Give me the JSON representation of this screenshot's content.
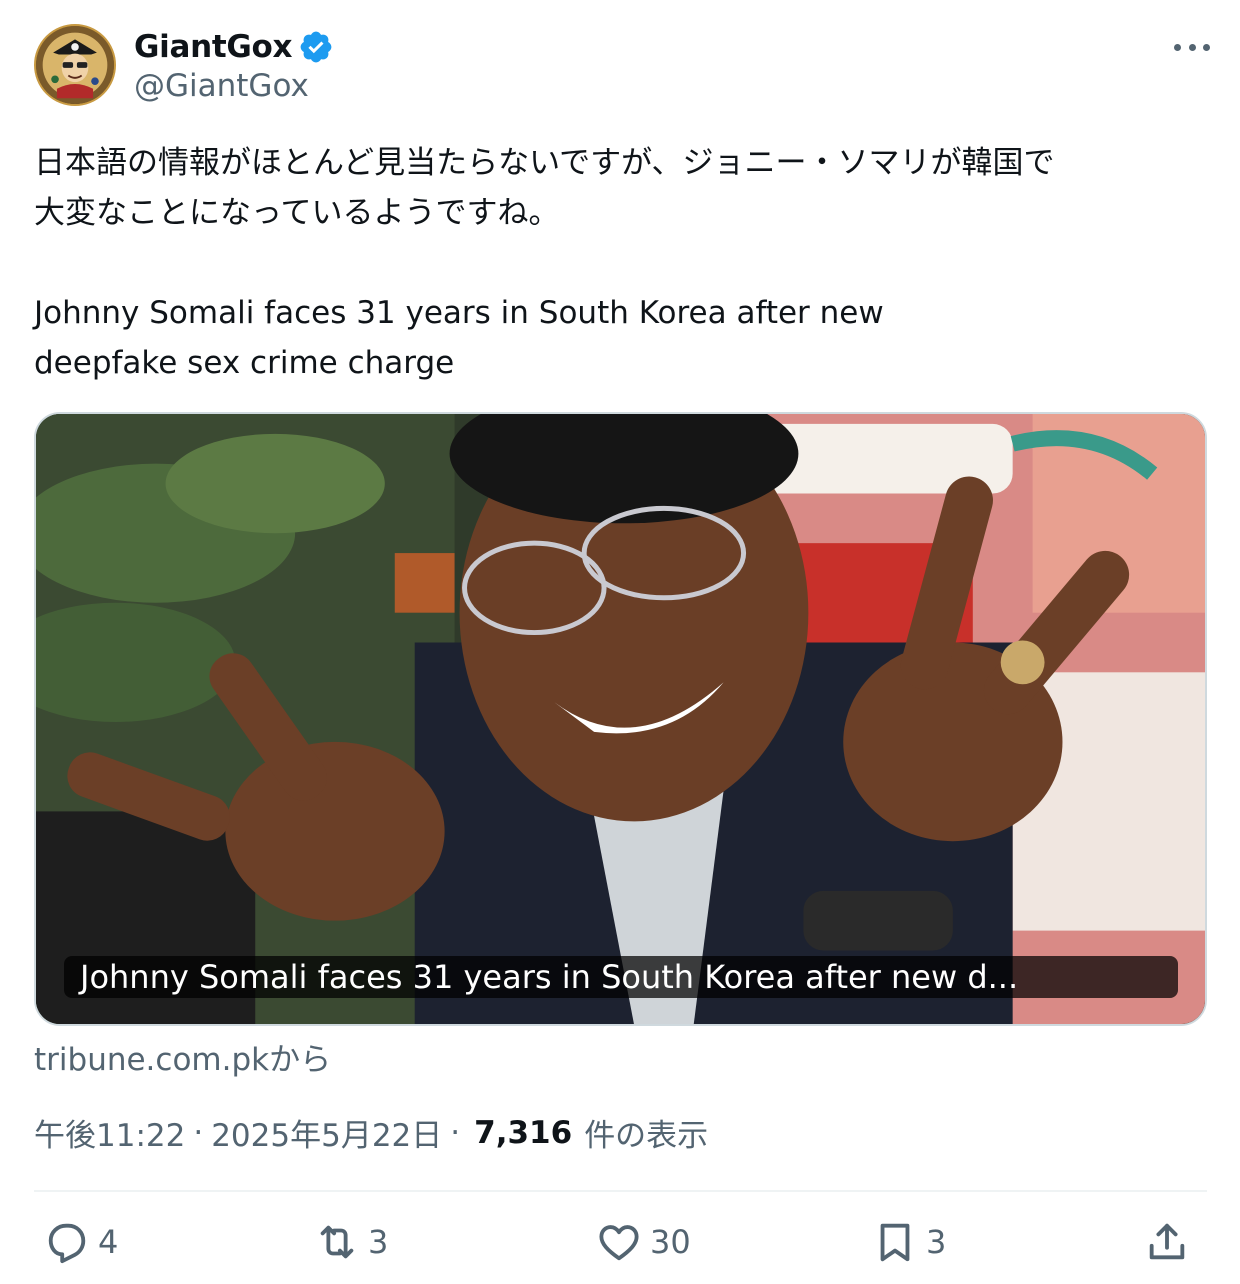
{
  "author": {
    "display_name": "GiantGox",
    "handle": "@GiantGox",
    "verified": true,
    "verified_color": "#1d9bf0"
  },
  "tweet": {
    "text_jp_line1": "日本語の情報がほとんど見当たらないですが、ジョニー・ソマリが韓国で",
    "text_jp_line2": "大変なことになっているようですね。",
    "text_en_line1": "Johnny Somali faces 31 years in South Korea after new",
    "text_en_line2": "deepfake sex crime charge"
  },
  "card": {
    "caption": "Johnny Somali faces 31 years in South Korea after new d...",
    "source": "tribune.com.pkから"
  },
  "meta": {
    "time": "午後11:22",
    "date": "2025年5月22日",
    "views_count": "7,316",
    "views_label": "件の表示",
    "separator": "·"
  },
  "actions": {
    "replies": "4",
    "reposts": "3",
    "likes": "30",
    "bookmarks": "3"
  },
  "icons": {
    "more": "more-icon",
    "reply": "reply-icon",
    "repost": "repost-icon",
    "like": "heart-icon",
    "bookmark": "bookmark-icon",
    "share": "share-icon",
    "verified": "verified-badge-icon"
  },
  "colors": {
    "text_primary": "#0f1419",
    "text_secondary": "#536471",
    "border": "#cfd9de"
  }
}
